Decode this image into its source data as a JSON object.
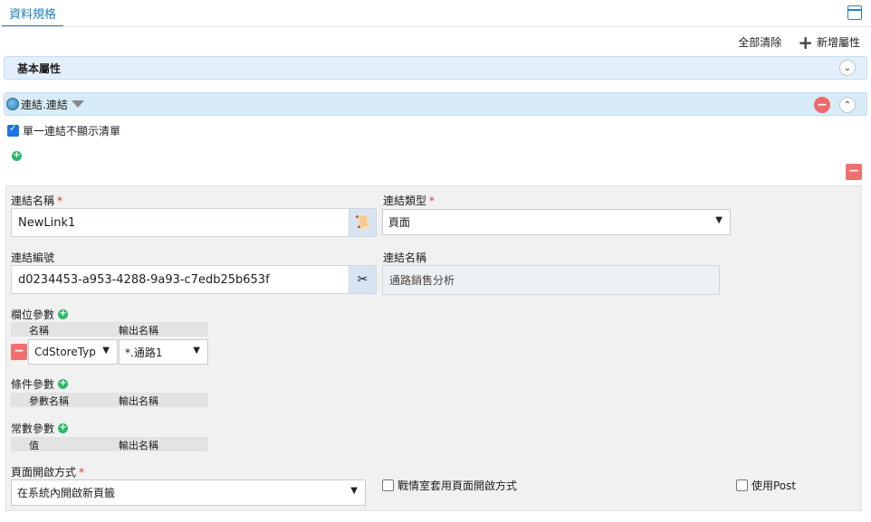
{
  "tab": {
    "label": "資料規格"
  },
  "toolbar": {
    "clear_all": "全部清除",
    "add_property": "新增屬性"
  },
  "sections": {
    "basic": {
      "title": "基本屬性"
    },
    "link": {
      "title": "連結.連結"
    }
  },
  "link_options": {
    "single_link_no_list": {
      "label": "單一連結不顯示清單",
      "checked": true
    }
  },
  "form": {
    "link_name": {
      "label": "連結名稱",
      "value": "NewLink1"
    },
    "link_type": {
      "label": "連結類型",
      "value": "頁面"
    },
    "link_id": {
      "label": "連結編號",
      "value": "d0234453-a953-4288-9a93-c7edb25b653f"
    },
    "link_name_display": {
      "label": "連結名稱",
      "value": "通路銷售分析"
    },
    "field_params": {
      "label": "欄位參數",
      "col_name": "名稱",
      "col_output": "輸出名稱",
      "rows": [
        {
          "name": "CdStoreTyp",
          "output": "*.通路1"
        }
      ]
    },
    "condition_params": {
      "label": "條件參數",
      "col_param": "參數名稱",
      "col_output": "輸出名稱"
    },
    "constant_params": {
      "label": "常數參數",
      "col_value": "值",
      "col_output": "輸出名稱"
    },
    "page_open_mode": {
      "label": "頁面開啟方式",
      "value": "在系統內開啟新頁籤"
    },
    "war_room_open": {
      "label": "戰情室套用頁面開啟方式",
      "checked": false
    },
    "use_post": {
      "label": "使用Post",
      "checked": false
    }
  },
  "colors": {
    "accent": "#1b7fc4",
    "header_bar": "#e3effb",
    "danger": "#f07070",
    "add_green": "#2db86b"
  }
}
